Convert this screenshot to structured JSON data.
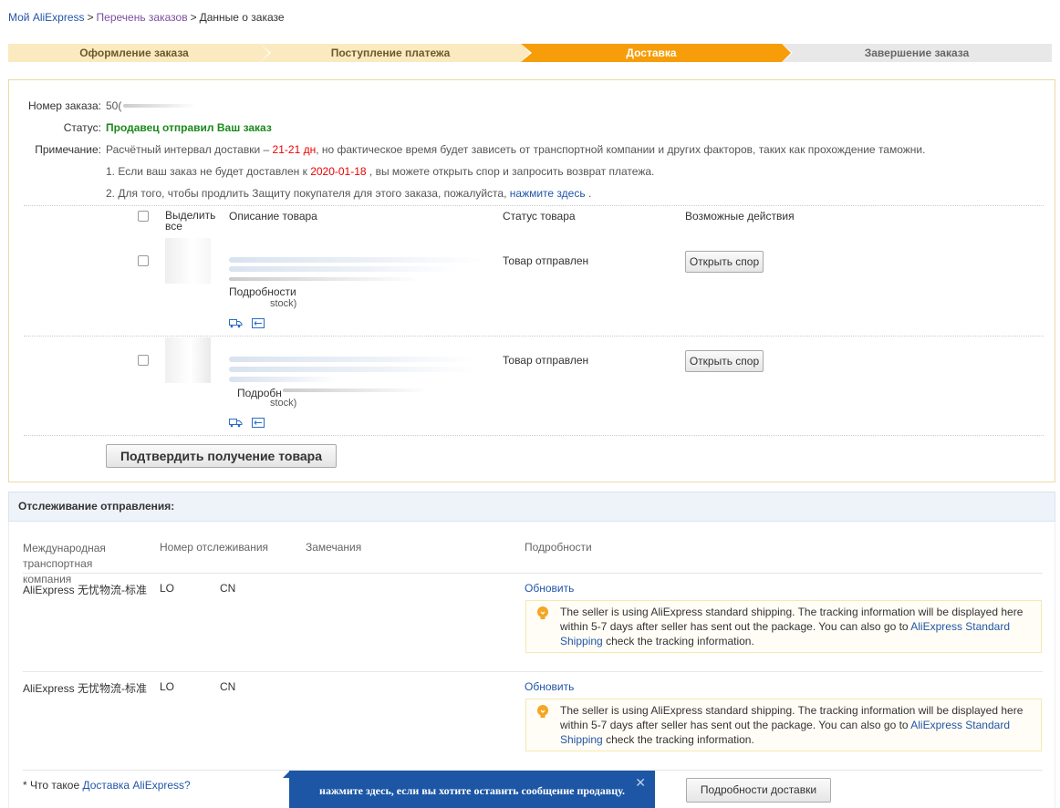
{
  "breadcrumb": {
    "item1": "Мой AliExpress",
    "item2": "Перечень заказов",
    "current": "Данные о заказе"
  },
  "steps": [
    "Оформление заказа",
    "Поступление платежа",
    "Доставка",
    "Завершение заказа"
  ],
  "order": {
    "number_label": "Номер заказа:",
    "number_value": "50(",
    "status_label": "Статус:",
    "status_value": "Продавец отправил Ваш заказ",
    "note_label": "Примечание:",
    "note_pre": "Расчётный интервал доставки –",
    "note_days": "21-21 дн",
    "note_post": ", но фактическое время будет зависеть от транспортной компании и других факторов, таких как прохождение таможни.",
    "note1_pre": "1. Если ваш заказ не будет доставлен к",
    "note1_date": "2020-01-18",
    "note1_post": ", вы можете открыть спор и запросить возврат платежа.",
    "note2_pre": "2. Для того, чтобы продлить Защиту покупателя для этого заказа, пожалуйста,",
    "note2_link": "нажмите здесь",
    "note2_post": "."
  },
  "table": {
    "col_select": "Выделить все",
    "col_desc": "Описание товара",
    "col_status": "Статус товара",
    "col_actions": "Возможные действия"
  },
  "products": [
    {
      "details_fragment": "Подробности",
      "stock_fragment": "stock)",
      "status": "Товар отправлен",
      "action": "Открыть спор"
    },
    {
      "details_fragment": "Подробн",
      "stock_fragment": "stock)",
      "status": "Товар отправлен",
      "action": "Открыть спор"
    }
  ],
  "confirm_button": "Подтвердить получение товара",
  "tracking": {
    "title": "Отслеживание отправления:",
    "col_company": "Международная транспортная компания",
    "col_number": "Номер отслеживания",
    "col_remarks": "Замечания",
    "col_details": "Подробности",
    "rows": [
      {
        "company": "AliExpress 无忧物流-标准",
        "number": "LO",
        "number_end": "CN",
        "refresh": "Обновить",
        "notice_text": "The seller is using AliExpress standard shipping. The tracking information will be displayed here within 5-7 days after seller has sent out the package. You can also go to",
        "notice_link": "AliExpress Standard Shipping",
        "notice_end": "check the tracking information."
      },
      {
        "company": "AliExpress 无忧物流-标准",
        "number": "LO",
        "number_end": "CN",
        "refresh": "Обновить",
        "notice_text": "The seller is using AliExpress standard shipping. The tracking information will be displayed here within 5-7 days after seller has sent out the package. You can also go to",
        "notice_link": "AliExpress Standard Shipping",
        "notice_end": "check the tracking information."
      }
    ],
    "footer_pre": "* Что такое",
    "footer_link": "Доставка AliExpress?",
    "details_button": "Подробности доставки"
  },
  "popup": {
    "text": "нажмите здесь, если вы хотите оставить сообщение продавцу.",
    "close": "✕"
  }
}
